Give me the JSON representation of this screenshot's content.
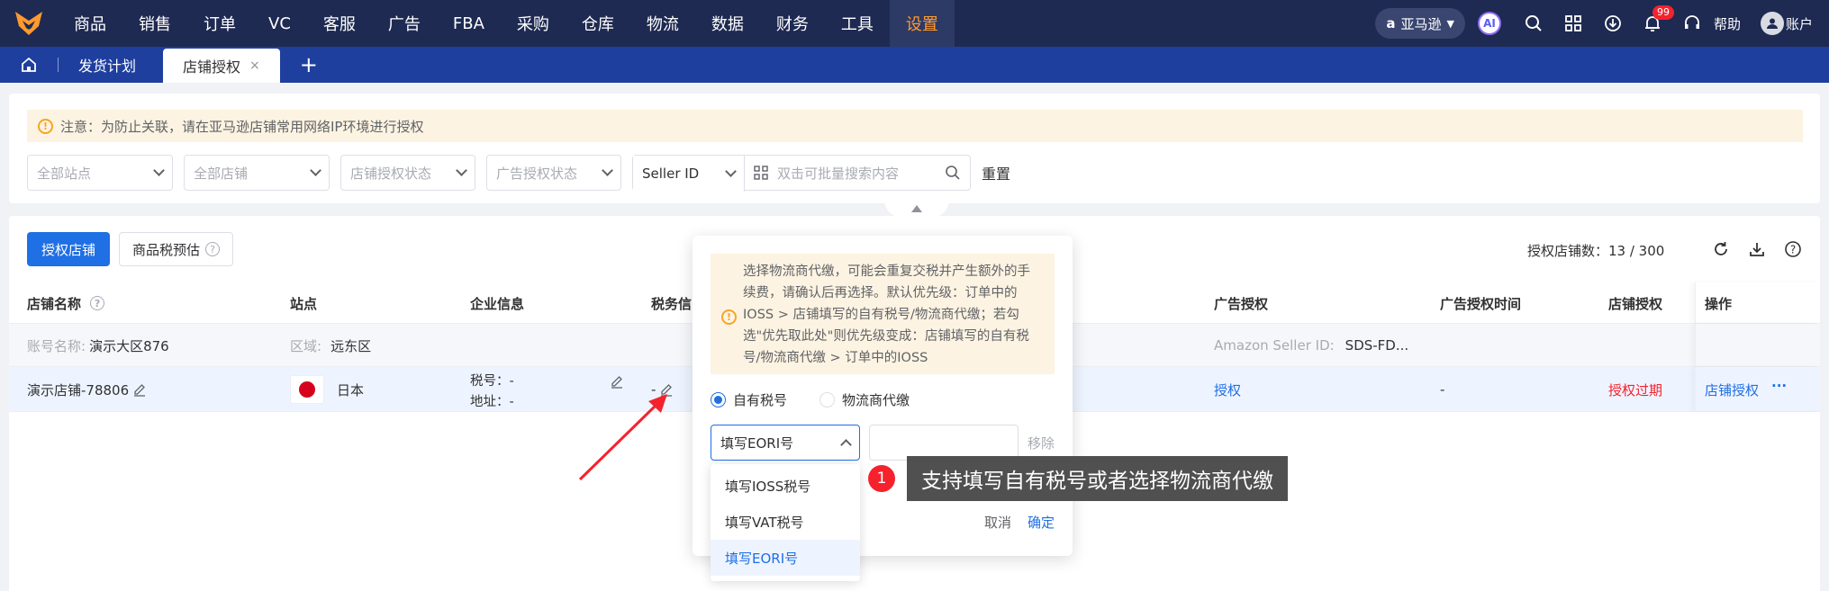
{
  "topnav": {
    "menu": [
      "商品",
      "销售",
      "订单",
      "VC",
      "客服",
      "广告",
      "FBA",
      "采购",
      "仓库",
      "物流",
      "数据",
      "财务",
      "工具",
      "设置"
    ],
    "active": "设置",
    "region": "亚马逊",
    "ai_label": "AI",
    "notification_count": "99",
    "help": "帮助",
    "account": "账户"
  },
  "tabs": {
    "items": [
      "发货计划",
      "店铺授权"
    ],
    "active": "店铺授权",
    "add": "+",
    "close": "×"
  },
  "filters": {
    "notice": "注意：为防止关联，请在亚马逊店铺常用网络IP环境进行授权",
    "site_placeholder": "全部站点",
    "store_placeholder": "全部店铺",
    "store_auth_placeholder": "店铺授权状态",
    "ad_auth_placeholder": "广告授权状态",
    "search_field": "Seller ID",
    "search_placeholder": "双击可批量搜索内容",
    "reset": "重置"
  },
  "toolbar": {
    "authorize_store": "授权店铺",
    "tax_estimate": "商品税预估",
    "count_label": "授权店铺数：13 / 300"
  },
  "table": {
    "headers": {
      "store_name": "店铺名称",
      "site": "站点",
      "company": "企业信息",
      "tax": "税务信",
      "ad_auth": "广告授权",
      "ad_auth_time": "广告授权时间",
      "store_auth": "店铺授权",
      "actions": "操作"
    },
    "group_row": {
      "account_label": "账号名称:",
      "account_value": "演示大区876",
      "region_label": "区域:",
      "region_value": "远东区",
      "seller_label": "Amazon Seller ID:",
      "seller_value": "SDS-FD..."
    },
    "row": {
      "store_name": "演示店铺-78806",
      "site": "日本",
      "tax_no_label": "税号：-",
      "address_label": "地址：-",
      "tax_value": "-",
      "ad_auth": "授权",
      "ad_auth_time": "-",
      "store_auth": "授权过期",
      "action_link": "店铺授权",
      "more": "···"
    }
  },
  "popover": {
    "warning": "选择物流商代缴，可能会重复交税并产生额外的手续费，请确认后再选择。默认优先级：订单中的IOSS > 店铺填写的自有税号/物流商代缴；若勾选\"优先取此处\"则优先级变成：店铺填写的自有税号/物流商代缴 > 订单中的IOSS",
    "radio_own": "自有税号",
    "radio_logistics": "物流商代缴",
    "selected_type": "填写EORI号",
    "remove": "移除",
    "cancel": "取消",
    "confirm": "确定",
    "options": [
      "填写IOSS税号",
      "填写VAT税号",
      "填写EORI号"
    ]
  },
  "callout": {
    "number": "1",
    "text": "支持填写自有税号或者选择物流商代缴"
  }
}
